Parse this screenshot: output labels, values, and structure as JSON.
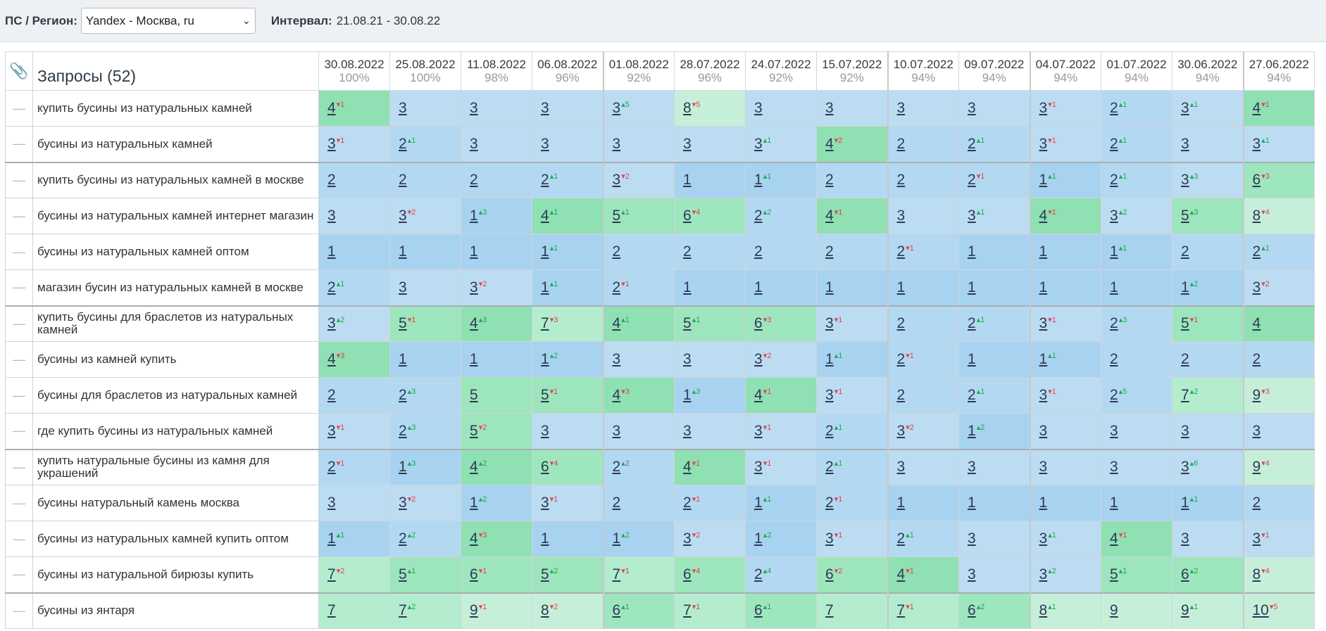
{
  "topbar": {
    "ps_label": "ПС / Регион:",
    "region_value": "Yandex - Москва, ru",
    "interval_label": "Интервал:",
    "interval_value": "21.08.21 - 30.08.22"
  },
  "table": {
    "query_header": "Запросы (52)",
    "dates": [
      {
        "date": "30.08.2022",
        "pct": "100%"
      },
      {
        "date": "25.08.2022",
        "pct": "100%"
      },
      {
        "date": "11.08.2022",
        "pct": "98%"
      },
      {
        "date": "06.08.2022",
        "pct": "96%"
      },
      {
        "date": "01.08.2022",
        "pct": "92%"
      },
      {
        "date": "28.07.2022",
        "pct": "96%"
      },
      {
        "date": "24.07.2022",
        "pct": "92%"
      },
      {
        "date": "15.07.2022",
        "pct": "92%"
      },
      {
        "date": "10.07.2022",
        "pct": "94%"
      },
      {
        "date": "09.07.2022",
        "pct": "94%"
      },
      {
        "date": "04.07.2022",
        "pct": "94%"
      },
      {
        "date": "01.07.2022",
        "pct": "94%"
      },
      {
        "date": "30.06.2022",
        "pct": "94%"
      },
      {
        "date": "27.06.2022",
        "pct": "94%"
      }
    ],
    "rows": [
      {
        "query": "купить бусины из натуральных камней",
        "cells": [
          [
            "4",
            "dn",
            "1"
          ],
          [
            "3"
          ],
          [
            "3"
          ],
          [
            "3"
          ],
          [
            "3",
            "up",
            "5"
          ],
          [
            "8",
            "dn",
            "5"
          ],
          [
            "3"
          ],
          [
            "3"
          ],
          [
            "3"
          ],
          [
            "3"
          ],
          [
            "3",
            "dn",
            "1"
          ],
          [
            "2",
            "up",
            "1"
          ],
          [
            "3",
            "up",
            "1"
          ],
          [
            "4",
            "dn",
            "1"
          ]
        ]
      },
      {
        "query": "бусины из натуральных камней",
        "cells": [
          [
            "3",
            "dn",
            "1"
          ],
          [
            "2",
            "up",
            "1"
          ],
          [
            "3"
          ],
          [
            "3"
          ],
          [
            "3"
          ],
          [
            "3"
          ],
          [
            "3",
            "up",
            "1"
          ],
          [
            "4",
            "dn",
            "2"
          ],
          [
            "2"
          ],
          [
            "2",
            "up",
            "1"
          ],
          [
            "3",
            "dn",
            "1"
          ],
          [
            "2",
            "up",
            "1"
          ],
          [
            "3"
          ],
          [
            "3",
            "up",
            "1"
          ]
        ]
      },
      {
        "query": "купить бусины из натуральных камней в москве",
        "cells": [
          [
            "2"
          ],
          [
            "2"
          ],
          [
            "2"
          ],
          [
            "2",
            "up",
            "1"
          ],
          [
            "3",
            "dn",
            "2"
          ],
          [
            "1"
          ],
          [
            "1",
            "up",
            "1"
          ],
          [
            "2"
          ],
          [
            "2"
          ],
          [
            "2",
            "dn",
            "1"
          ],
          [
            "1",
            "up",
            "1"
          ],
          [
            "2",
            "up",
            "1"
          ],
          [
            "3",
            "up",
            "3"
          ],
          [
            "6",
            "dn",
            "3"
          ]
        ]
      },
      {
        "query": "бусины из натуральных камней интернет магазин",
        "cells": [
          [
            "3"
          ],
          [
            "3",
            "dn",
            "2"
          ],
          [
            "1",
            "up",
            "3"
          ],
          [
            "4",
            "up",
            "1"
          ],
          [
            "5",
            "up",
            "1"
          ],
          [
            "6",
            "dn",
            "4"
          ],
          [
            "2",
            "up",
            "2"
          ],
          [
            "4",
            "dn",
            "1"
          ],
          [
            "3"
          ],
          [
            "3",
            "up",
            "1"
          ],
          [
            "4",
            "dn",
            "1"
          ],
          [
            "3",
            "up",
            "2"
          ],
          [
            "5",
            "up",
            "3"
          ],
          [
            "8",
            "dn",
            "4"
          ]
        ]
      },
      {
        "query": "бусины из натуральных камней оптом",
        "cells": [
          [
            "1"
          ],
          [
            "1"
          ],
          [
            "1"
          ],
          [
            "1",
            "up",
            "1"
          ],
          [
            "2"
          ],
          [
            "2"
          ],
          [
            "2"
          ],
          [
            "2"
          ],
          [
            "2",
            "dn",
            "1"
          ],
          [
            "1"
          ],
          [
            "1"
          ],
          [
            "1",
            "up",
            "1"
          ],
          [
            "2"
          ],
          [
            "2",
            "up",
            "1"
          ]
        ]
      },
      {
        "query": "магазин бусин из натуральных камней в москве",
        "cells": [
          [
            "2",
            "up",
            "1"
          ],
          [
            "3"
          ],
          [
            "3",
            "dn",
            "2"
          ],
          [
            "1",
            "up",
            "1"
          ],
          [
            "2",
            "dn",
            "1"
          ],
          [
            "1"
          ],
          [
            "1"
          ],
          [
            "1"
          ],
          [
            "1"
          ],
          [
            "1"
          ],
          [
            "1"
          ],
          [
            "1"
          ],
          [
            "1",
            "up",
            "2"
          ],
          [
            "3",
            "dn",
            "2"
          ]
        ]
      },
      {
        "query": "купить бусины для браслетов из натуральных камней",
        "cells": [
          [
            "3",
            "up",
            "2"
          ],
          [
            "5",
            "dn",
            "1"
          ],
          [
            "4",
            "up",
            "3"
          ],
          [
            "7",
            "dn",
            "3"
          ],
          [
            "4",
            "up",
            "1"
          ],
          [
            "5",
            "up",
            "1"
          ],
          [
            "6",
            "dn",
            "3"
          ],
          [
            "3",
            "dn",
            "1"
          ],
          [
            "2"
          ],
          [
            "2",
            "up",
            "1"
          ],
          [
            "3",
            "dn",
            "1"
          ],
          [
            "2",
            "up",
            "3"
          ],
          [
            "5",
            "dn",
            "1"
          ],
          [
            "4"
          ]
        ]
      },
      {
        "query": "бусины из камней купить",
        "cells": [
          [
            "4",
            "dn",
            "3"
          ],
          [
            "1"
          ],
          [
            "1"
          ],
          [
            "1",
            "up",
            "2"
          ],
          [
            "3"
          ],
          [
            "3"
          ],
          [
            "3",
            "dn",
            "2"
          ],
          [
            "1",
            "up",
            "1"
          ],
          [
            "2",
            "dn",
            "1"
          ],
          [
            "1"
          ],
          [
            "1",
            "up",
            "1"
          ],
          [
            "2"
          ],
          [
            "2"
          ],
          [
            "2"
          ]
        ]
      },
      {
        "query": "бусины для браслетов из натуральных камней",
        "cells": [
          [
            "2"
          ],
          [
            "2",
            "up",
            "3"
          ],
          [
            "5"
          ],
          [
            "5",
            "dn",
            "1"
          ],
          [
            "4",
            "dn",
            "3"
          ],
          [
            "1",
            "up",
            "3"
          ],
          [
            "4",
            "dn",
            "1"
          ],
          [
            "3",
            "dn",
            "1"
          ],
          [
            "2"
          ],
          [
            "2",
            "up",
            "1"
          ],
          [
            "3",
            "dn",
            "1"
          ],
          [
            "2",
            "up",
            "5"
          ],
          [
            "7",
            "up",
            "2"
          ],
          [
            "9",
            "dn",
            "3"
          ]
        ]
      },
      {
        "query": "где купить бусины из натуральных камней",
        "cells": [
          [
            "3",
            "dn",
            "1"
          ],
          [
            "2",
            "up",
            "3"
          ],
          [
            "5",
            "dn",
            "2"
          ],
          [
            "3"
          ],
          [
            "3"
          ],
          [
            "3"
          ],
          [
            "3",
            "dn",
            "1"
          ],
          [
            "2",
            "up",
            "1"
          ],
          [
            "3",
            "dn",
            "2"
          ],
          [
            "1",
            "up",
            "2"
          ],
          [
            "3"
          ],
          [
            "3"
          ],
          [
            "3"
          ],
          [
            "3"
          ]
        ]
      },
      {
        "query": "купить натуральные бусины из камня для украшений",
        "cells": [
          [
            "2",
            "dn",
            "1"
          ],
          [
            "1",
            "up",
            "3"
          ],
          [
            "4",
            "up",
            "2"
          ],
          [
            "6",
            "dn",
            "4"
          ],
          [
            "2",
            "up",
            "2"
          ],
          [
            "4",
            "dn",
            "1"
          ],
          [
            "3",
            "dn",
            "1"
          ],
          [
            "2",
            "up",
            "1"
          ],
          [
            "3"
          ],
          [
            "3"
          ],
          [
            "3"
          ],
          [
            "3"
          ],
          [
            "3",
            "up",
            "6"
          ],
          [
            "9",
            "dn",
            "4"
          ]
        ]
      },
      {
        "query": "бусины натуральный камень москва",
        "cells": [
          [
            "3"
          ],
          [
            "3",
            "dn",
            "2"
          ],
          [
            "1",
            "up",
            "2"
          ],
          [
            "3",
            "dn",
            "1"
          ],
          [
            "2"
          ],
          [
            "2",
            "dn",
            "1"
          ],
          [
            "1",
            "up",
            "1"
          ],
          [
            "2",
            "dn",
            "1"
          ],
          [
            "1"
          ],
          [
            "1"
          ],
          [
            "1"
          ],
          [
            "1"
          ],
          [
            "1",
            "up",
            "1"
          ],
          [
            "2"
          ]
        ]
      },
      {
        "query": "бусины из натуральных камней купить оптом",
        "cells": [
          [
            "1",
            "up",
            "1"
          ],
          [
            "2",
            "up",
            "2"
          ],
          [
            "4",
            "dn",
            "3"
          ],
          [
            "1"
          ],
          [
            "1",
            "up",
            "2"
          ],
          [
            "3",
            "dn",
            "2"
          ],
          [
            "1",
            "up",
            "2"
          ],
          [
            "3",
            "dn",
            "1"
          ],
          [
            "2",
            "up",
            "1"
          ],
          [
            "3"
          ],
          [
            "3",
            "up",
            "1"
          ],
          [
            "4",
            "dn",
            "1"
          ],
          [
            "3"
          ],
          [
            "3",
            "dn",
            "1"
          ]
        ]
      },
      {
        "query": "бусины из натуральной бирюзы купить",
        "cells": [
          [
            "7",
            "dn",
            "2"
          ],
          [
            "5",
            "up",
            "1"
          ],
          [
            "6",
            "dn",
            "1"
          ],
          [
            "5",
            "up",
            "2"
          ],
          [
            "7",
            "dn",
            "1"
          ],
          [
            "6",
            "dn",
            "4"
          ],
          [
            "2",
            "up",
            "4"
          ],
          [
            "6",
            "dn",
            "2"
          ],
          [
            "4",
            "dn",
            "1"
          ],
          [
            "3"
          ],
          [
            "3",
            "up",
            "2"
          ],
          [
            "5",
            "up",
            "1"
          ],
          [
            "6",
            "up",
            "2"
          ],
          [
            "8",
            "dn",
            "4"
          ]
        ]
      },
      {
        "query": "бусины из янтаря",
        "cells": [
          [
            "7"
          ],
          [
            "7",
            "up",
            "2"
          ],
          [
            "9",
            "dn",
            "1"
          ],
          [
            "8",
            "dn",
            "2"
          ],
          [
            "6",
            "up",
            "1"
          ],
          [
            "7",
            "dn",
            "1"
          ],
          [
            "6",
            "up",
            "1"
          ],
          [
            "7"
          ],
          [
            "7",
            "dn",
            "1"
          ],
          [
            "6",
            "up",
            "2"
          ],
          [
            "8",
            "up",
            "1"
          ],
          [
            "9"
          ],
          [
            "9",
            "up",
            "1"
          ],
          [
            "10",
            "dn",
            "5"
          ]
        ]
      }
    ]
  }
}
